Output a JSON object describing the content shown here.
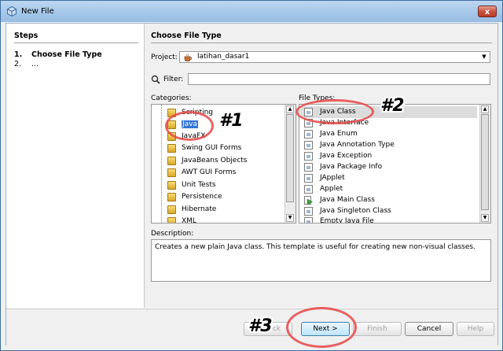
{
  "window": {
    "title": "New File",
    "close_label": "x"
  },
  "steps": {
    "heading": "Steps",
    "items": [
      {
        "num": "1.",
        "label": "Choose File Type"
      },
      {
        "num": "2.",
        "label": "..."
      }
    ]
  },
  "main": {
    "heading": "Choose File Type",
    "project_label": "Project:",
    "project_value": "latihan_dasar1",
    "filter_label": "Filter:",
    "filter_value": "",
    "categories_label": "Categories:",
    "file_types_label": "File Types:",
    "categories": [
      "Scripting",
      "Java",
      "JavaFX",
      "Swing GUI Forms",
      "JavaBeans Objects",
      "AWT GUI Forms",
      "Unit Tests",
      "Persistence",
      "Hibernate",
      "XML"
    ],
    "selected_category": "Java",
    "file_types": [
      "Java Class",
      "Java Interface",
      "Java Enum",
      "Java Annotation Type",
      "Java Exception",
      "Java Package Info",
      "JApplet",
      "Applet",
      "Java Main Class",
      "Java Singleton Class",
      "Empty Java File"
    ],
    "selected_file_type": "Java Class",
    "description_label": "Description:",
    "description": "Creates a new plain Java class. This template is useful for creating new non-visual classes."
  },
  "buttons": {
    "back": "< Back",
    "next": "Next >",
    "finish": "Finish",
    "cancel": "Cancel",
    "help": "Help"
  },
  "annotations": {
    "one": "#1",
    "two": "#2",
    "three": "#3"
  },
  "colors": {
    "selection": "#3375d6",
    "annotation_ring": "#e64646"
  }
}
